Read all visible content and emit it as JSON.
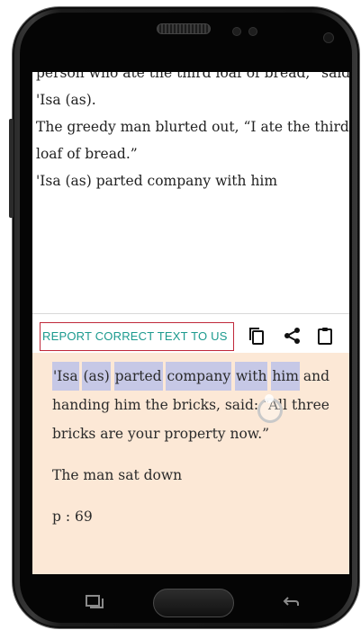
{
  "book": {
    "lines": [
      "person who ate the third loaf of bread,” said",
      "'Isa (as).",
      "The greedy man blurted out, “I ate the third",
      "loaf of bread.”",
      "'Isa (as) parted company with him"
    ]
  },
  "toolbar": {
    "report_label": "REPORT CORRECT TEXT TO US",
    "icons": [
      "copy-icon",
      "share-icon",
      "clipboard-icon"
    ]
  },
  "panel": {
    "line1_words": [
      "'Isa",
      "(as)",
      "parted",
      "company",
      "with",
      "him",
      "and"
    ],
    "line2_words": [
      "handing",
      "him",
      "the",
      "bricks,",
      "said:",
      "“All",
      "three"
    ],
    "line3": "bricks are your property now.”",
    "line4": "The man sat down",
    "page": "p : 69"
  },
  "colors": {
    "accent": "#1b9a8e",
    "report_border": "#c0283a",
    "panel_bg": "#fce8d6",
    "selection": "#c6c8e6"
  }
}
